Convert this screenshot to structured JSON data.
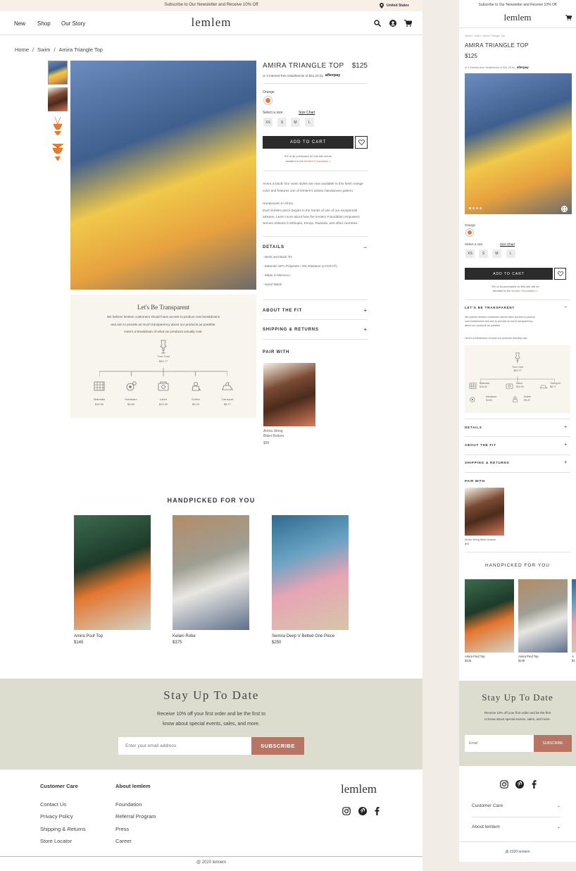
{
  "announce": {
    "text": "Subscribe to Our Newsletter and Receive 10% Off",
    "region": "United States"
  },
  "nav": {
    "items": [
      "New",
      "Shop",
      "Our Story"
    ],
    "logo": "lemlem"
  },
  "breadcrumb": {
    "home": "Home",
    "swim": "Swim",
    "current": "Amira Triangle Top",
    "sep": "/"
  },
  "product": {
    "title": "AMIRA TRIANGLE TOP",
    "price": "$125",
    "installments_pre": "or 4 interest-free installments of $31.25 by",
    "afterpay": "afterpay",
    "color_label": "Orange",
    "size_label": "Select a size",
    "size_chart": "Size Chart",
    "sizes": [
      "XS",
      "S",
      "M",
      "L"
    ],
    "add_to_cart": "ADD TO CART",
    "donation_line1": "5% of all purchases on this site will be",
    "donation_line2_pre": "donated to the",
    "donation_link": "lemlem Foundation >",
    "desc1": "Amira is back! Our swim styles are now available in this fresh orange",
    "desc2": "color and features one of lemlem's classic handwoven pattern.",
    "desc3": "Handwoven in Africa.",
    "desc4": "Each lemlem piece begins in the hands of one of our exceptional",
    "desc5": "artisans. Learn more about how the lemlem Foundation empowers",
    "desc6": "women artisans in Ethiopia, Kenya, Rwanda, and other countries.",
    "details_label": "DETAILS",
    "details": [
      "Neck and Back Tie",
      "Material: 92% Polyester / 8% Elastane (LYCRA®)",
      "Made in Morocco",
      "Hand Wash"
    ],
    "about_fit": "ABOUT THE FIT",
    "shipping": "SHIPPING & RETURNS",
    "pair_with": "PAIR WITH",
    "pair_name1": "Amira String",
    "pair_name2": "Bikini Bottom",
    "pair_price": "$95"
  },
  "transparent": {
    "title": "Let's Be Transparent",
    "line1": "We believe lemlem customers should have access to product cost breakdowns",
    "line2": "and aim to provide as much transparency about our products as possible.",
    "line3": "Here's a breakdown of what our products actually cost.",
    "true_cost_label": "True Cost",
    "true_cost_value": "$62.77",
    "items": [
      {
        "name": "Materials",
        "value": "$16.50"
      },
      {
        "name": "Hardware",
        "value": "$3.80"
      },
      {
        "name": "Labor",
        "value": "$23.90"
      },
      {
        "name": "Duties",
        "value": "$9.20"
      },
      {
        "name": "Transport",
        "value": "$8.77"
      }
    ]
  },
  "handpicked": {
    "title": "HANDPICKED FOR YOU",
    "items": [
      {
        "name": "Amira Pouf Top",
        "price": "$145"
      },
      {
        "name": "Kelani Robe",
        "price": "$375"
      },
      {
        "name": "Semira Deep V Belted One Piece",
        "price": "$250"
      }
    ]
  },
  "newsletter": {
    "title": "Stay Up To Date",
    "line1": "Receive 10% off your first order and be the first to",
    "line2": "know about special events, sales, and more.",
    "placeholder": "Enter your email address",
    "button": "SUBSCRIBE"
  },
  "footer": {
    "col1_title": "Customer Care",
    "col1": [
      "Contact Us",
      "Privacy Policy",
      "Shipping & Returns",
      "Store Locator"
    ],
    "col2_title": "About lemlem",
    "col2": [
      "Foundation",
      "Referral Program",
      "Press",
      "Career"
    ],
    "logo": "lemlem",
    "copyright": "@ 2020 lemlem"
  },
  "mobile": {
    "announce": "Subscribe to Our Newsletter and Receive 10% Off",
    "logo": "lemlem",
    "breadcrumb": "Home / Swim / Amira Triangle Top",
    "title": "AMIRA TRIANGLE TOP",
    "price": "$125",
    "installments": "or 4 interest-free installments of $31.25 by",
    "afterpay": "afterpay",
    "color_label": "Orange",
    "size_label": "Select a size",
    "size_chart": "Size Chart",
    "sizes": [
      "XS",
      "S",
      "M",
      "L"
    ],
    "add_to_cart": "ADD TO CART",
    "donation_line1": "5% of all purchases on this site will be",
    "donation_line2_pre": "donated to the",
    "donation_link": "lemlem Foundation >",
    "transparent_label": "LET'S BE TRANSPARENT",
    "t_line1": "We believe lemlem customers should have access to product",
    "t_line2": "cost breakdowns and aim to provide as much transparency",
    "t_line3": "about our products as possible.",
    "t_line4": "Here's a breakdown of what our products actually cost.",
    "true_cost_label": "True Cost",
    "true_cost_value": "$62.77",
    "cost_items": [
      {
        "name": "Materials",
        "value": "$16.50"
      },
      {
        "name": "Labor",
        "value": "$23.90"
      },
      {
        "name": "Transport",
        "value": "$8.77"
      },
      {
        "name": "Hardware",
        "value": "$3.80"
      },
      {
        "name": "Duties",
        "value": "$9.20"
      }
    ],
    "details": "DETAILS",
    "about_fit": "ABOUT THE FIT",
    "shipping": "SHIPPING & RETURNS",
    "pair_with": "PAIR WITH",
    "pair_name": "Amira String Bikini Bottom",
    "pair_price": "$95",
    "handpicked": "HANDPICKED FOR YOU",
    "hp_items": [
      {
        "name": "Amira Pouf Top",
        "price": "$145"
      },
      {
        "name": "Amira Pouf Top",
        "price": "$145"
      },
      {
        "name": "A",
        "price": "$1"
      }
    ],
    "newsletter_title": "Stay Up To Date",
    "nl_line1": "Receive 10% off your first order and be the first",
    "nl_line2": "to know about special events, sales, and more.",
    "email_placeholder": "Email",
    "subscribe": "SUBSCRIBE",
    "customer_care": "Customer Care",
    "about_lemlem": "About lemlem",
    "copyright": "@ 2020 lemlem"
  }
}
